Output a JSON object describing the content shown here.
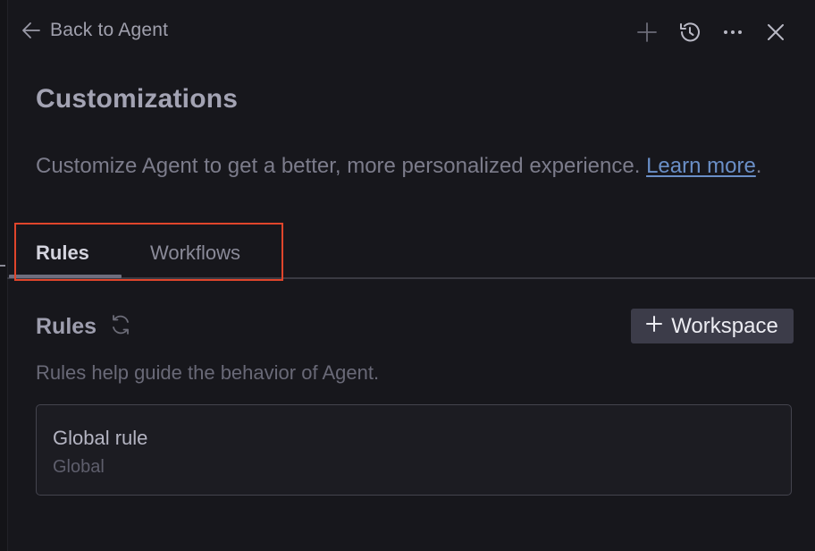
{
  "header": {
    "back_label": "Back to Agent",
    "actions": [
      {
        "icon": "plus-icon"
      },
      {
        "icon": "history-icon"
      },
      {
        "icon": "more-icon"
      },
      {
        "icon": "close-icon"
      }
    ]
  },
  "page": {
    "title": "Customizations",
    "description": "Customize Agent to get a better, more personalized experience. ",
    "learn_more": "Learn more",
    "description_end": "."
  },
  "tabs": [
    {
      "label": "Rules",
      "active": true
    },
    {
      "label": "Workflows",
      "active": false
    }
  ],
  "rules_section": {
    "title": "Rules",
    "refresh_icon": "refresh-icon",
    "add_button_label": "Workspace",
    "add_button_icon": "plus-icon",
    "description": "Rules help guide the behavior of Agent."
  },
  "rules": [
    {
      "name": "Global rule",
      "scope": "Global"
    }
  ],
  "colors": {
    "background": "#17171c",
    "accent_link": "#6a8fc7",
    "highlight": "#e0452b",
    "button_bg": "#3c3c49"
  }
}
